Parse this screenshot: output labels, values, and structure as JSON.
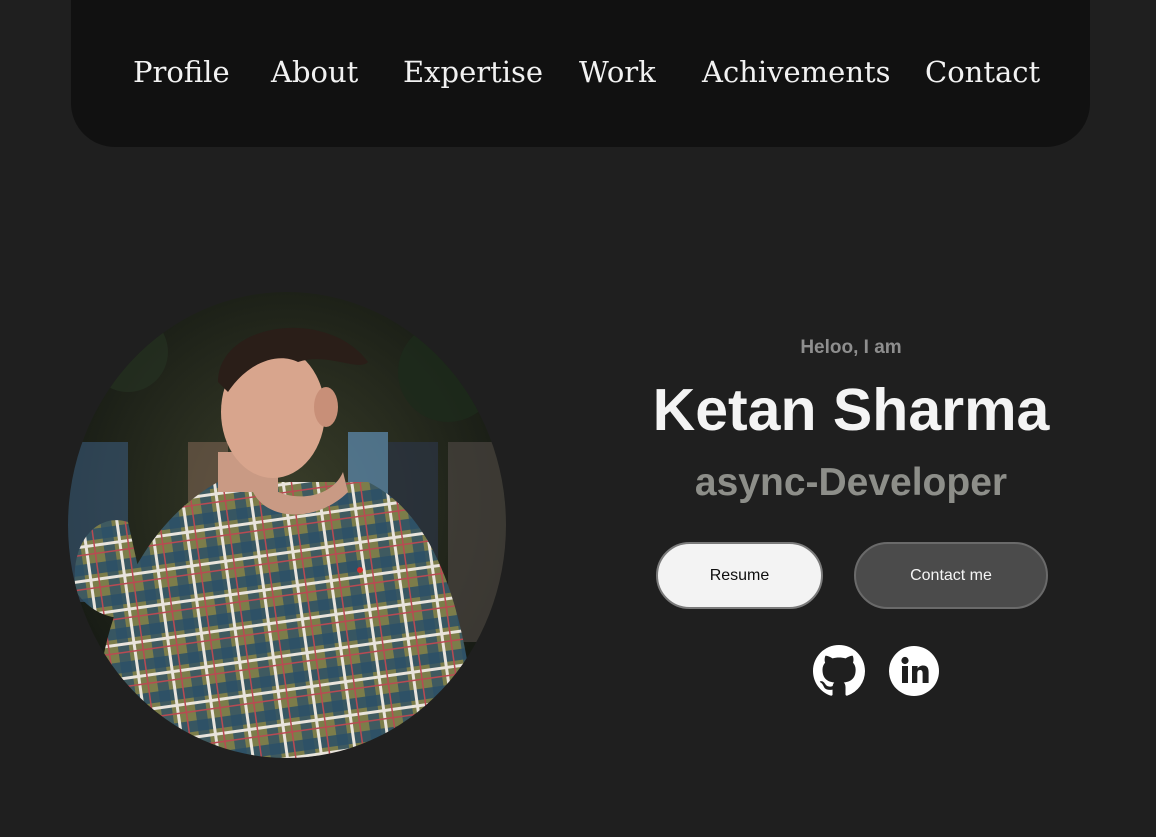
{
  "nav": {
    "items": [
      "Profile",
      "About",
      "Expertise",
      "Work",
      "Achivements",
      "Contact"
    ]
  },
  "hero": {
    "greeting": "Heloo, I am",
    "name": "Ketan Sharma",
    "role": "async-Developer",
    "resume_label": "Resume",
    "contact_label": "Contact me"
  },
  "social": {
    "icons": [
      "github-icon",
      "linkedin-icon"
    ]
  },
  "colors": {
    "page_bg": "#1f1f1f",
    "nav_bg": "#111111",
    "greeting": "#8e8e8e",
    "role": "#8d8e89",
    "contact_button_bg": "#4b4b4b"
  }
}
